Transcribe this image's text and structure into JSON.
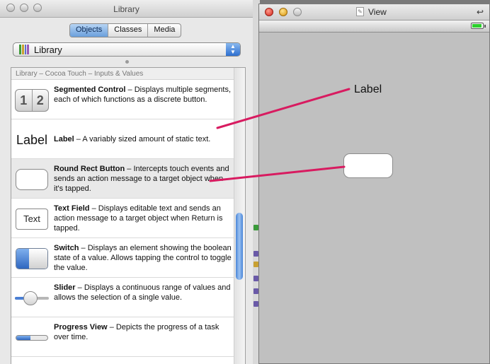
{
  "library": {
    "title": "Library",
    "tabs": [
      {
        "label": "Objects",
        "active": true
      },
      {
        "label": "Classes",
        "active": false
      },
      {
        "label": "Media",
        "active": false
      }
    ],
    "popup": {
      "value": "Library",
      "icon": "library-books-icon"
    },
    "list_header": "Library – Cocoa Touch – Inputs & Values",
    "items": [
      {
        "name": "Segmented Control",
        "desc": "– Displays multiple segments, each of which functions as a discrete button.",
        "icon": "segmented-control-icon"
      },
      {
        "name": "Label",
        "desc": "– A variably sized amount of static text.",
        "icon": "label-icon",
        "icon_text": "Label"
      },
      {
        "name": "Round Rect Button",
        "desc": "– Intercepts touch events and sends an action message to a target object when it's tapped.",
        "icon": "round-rect-button-icon",
        "selected": true
      },
      {
        "name": "Text Field",
        "desc": "– Displays editable text and sends an action message to a target object when Return is tapped.",
        "icon": "text-field-icon",
        "icon_text": "Text"
      },
      {
        "name": "Switch",
        "desc": "– Displays an element showing the boolean state of a value. Allows tapping the control to toggle the value.",
        "icon": "switch-icon"
      },
      {
        "name": "Slider",
        "desc": "– Displays a continuous range of values and allows the selection of a single value.",
        "icon": "slider-icon",
        "level": 0.45
      },
      {
        "name": "Progress View",
        "desc": "– Depicts the progress of a task over time.",
        "icon": "progress-view-icon",
        "level": 0.45
      }
    ],
    "segment_glyphs": [
      "1",
      "2"
    ]
  },
  "view_window": {
    "title": "View",
    "canvas_label": "Label",
    "battery_icon": "battery-icon",
    "return_icon": "return-arrow-icon"
  },
  "colors": {
    "drag_line": "#d81b60",
    "selection_blue": "#4a86d8",
    "battery_green": "#2ccf2c"
  }
}
